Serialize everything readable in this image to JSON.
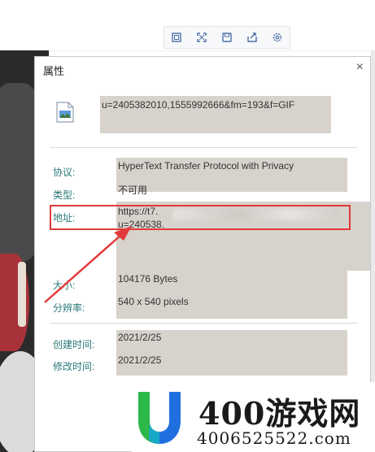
{
  "toolbar": {
    "icons": [
      "crop-icon",
      "fullscreen-icon",
      "save-icon",
      "share-icon",
      "settings-icon"
    ]
  },
  "dialog": {
    "title": "属性",
    "close": "×",
    "filename": "u=2405382010,1555992666&fm=193&f=GIF",
    "rows": {
      "protocol": {
        "label": "协议:",
        "value": "HyperText Transfer Protocol with Privacy"
      },
      "type": {
        "label": "类型:",
        "value": "不可用"
      },
      "address": {
        "label": "地址:",
        "value_line1": "https://t7.",
        "value_line2": "u=240538."
      },
      "size": {
        "label": "大小:",
        "value": "104176 Bytes"
      },
      "resolution": {
        "label": "分辨率:",
        "value": "540 x 540 pixels"
      },
      "created": {
        "label": "创建时间:",
        "value": "2021/2/25"
      },
      "modified": {
        "label": "修改时间:",
        "value": "2021/2/25"
      }
    }
  },
  "watermark": {
    "brand": "400游戏网",
    "domain": "4006525522.com"
  },
  "colors": {
    "label_teal": "#2a7a78",
    "value_box": "#d7d2cc",
    "highlight_red": "#e23a3a",
    "logo_green": "#2db84a",
    "logo_blue": "#1f6fe0"
  }
}
